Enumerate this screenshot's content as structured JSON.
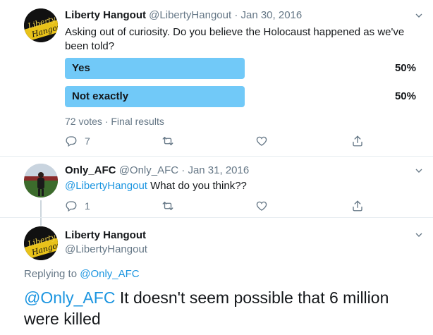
{
  "tweet1": {
    "display_name": "Liberty Hangout",
    "handle": "@LibertyHangout",
    "separator": "·",
    "date": "Jan 30, 2016",
    "text": "Asking out of curiosity. Do you believe the Holocaust happened as we've been told?",
    "poll": {
      "options": [
        {
          "label": "Yes",
          "percent": "50%",
          "share": 0.5
        },
        {
          "label": "Not exactly",
          "percent": "50%",
          "share": 0.5
        }
      ],
      "summary": "72 votes · Final results"
    },
    "actions": {
      "reply_count": "7"
    }
  },
  "tweet2": {
    "display_name": "Only_AFC",
    "handle": "@Only_AFC",
    "separator": "·",
    "date": "Jan 31, 2016",
    "mention": "@LibertyHangout",
    "text": " What do you think??",
    "actions": {
      "reply_count": "1"
    }
  },
  "tweet3": {
    "display_name": "Liberty Hangout",
    "handle": "@LibertyHangout",
    "replying_prefix": "Replying to ",
    "replying_to": "@Only_AFC",
    "mention": "@Only_AFC",
    "text": " It doesn't seem possible that 6 million were killed"
  },
  "avatar_text": "Liberty Hangout",
  "colors": {
    "poll_fill": "#71c9f8",
    "link": "#1b95e0",
    "muted": "#657786"
  },
  "icons": [
    "reply-icon",
    "retweet-icon",
    "like-icon",
    "share-icon",
    "chevron-down-icon"
  ]
}
